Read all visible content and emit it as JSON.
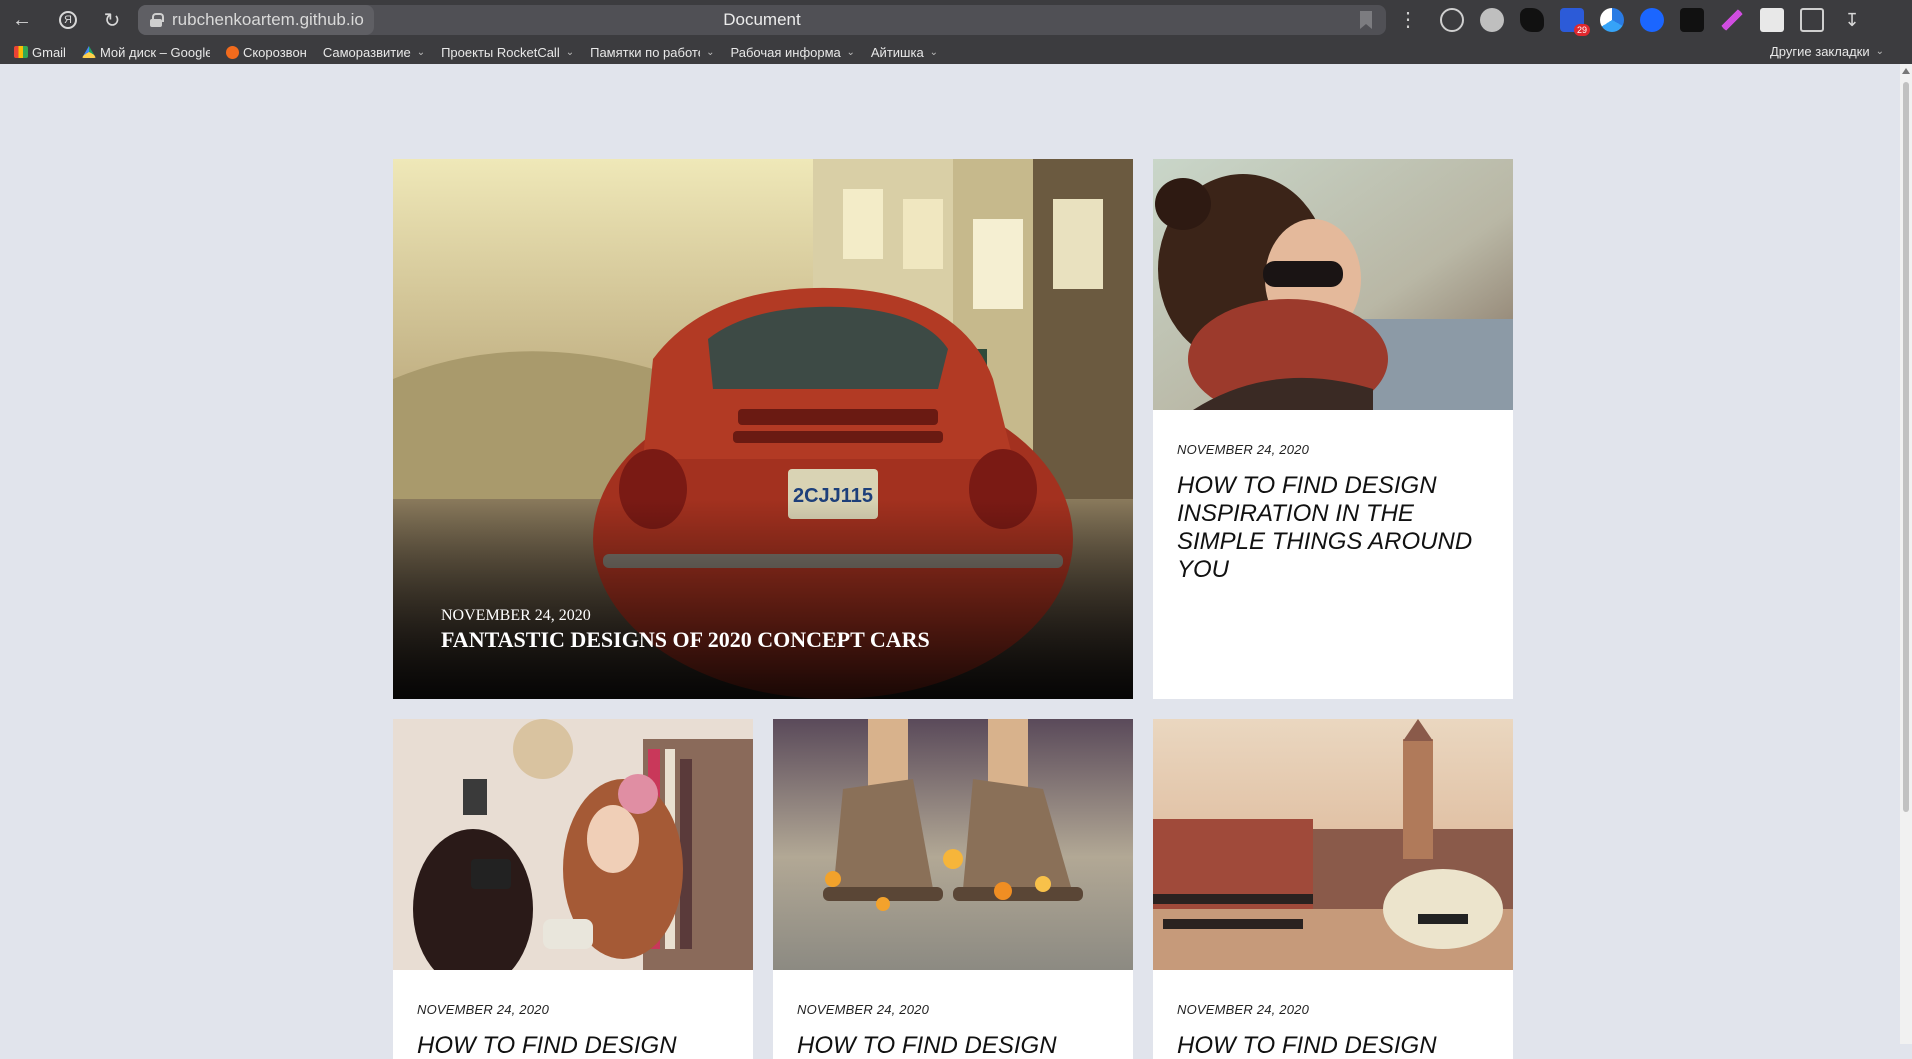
{
  "browser": {
    "url": "rubchenkoartem.github.io",
    "title": "Document",
    "extension_badge": "29",
    "bookmarks": [
      {
        "label": "Gmail",
        "icon": "gmail-icon",
        "color": "#ea4335",
        "folder": false
      },
      {
        "label": "Мой диск – Google",
        "icon": "google-drive-icon",
        "color": "#1fa463",
        "folder": false
      },
      {
        "label": "Скорозвон",
        "icon": "skorozvon-icon",
        "color": "#f26b1d",
        "folder": false
      },
      {
        "label": "Саморазвитие",
        "folder": true
      },
      {
        "label": "Проекты RocketCall",
        "folder": true
      },
      {
        "label": "Памятки по работе",
        "folder": true
      },
      {
        "label": "Рабочая информация",
        "folder": true
      },
      {
        "label": "Айтишка",
        "folder": true
      }
    ],
    "other_bookmarks": "Другие закладки"
  },
  "posts": {
    "featured": {
      "date": "NOVEMBER 24, 2020",
      "title": "FANTASTIC DESIGNS OF 2020 CONCEPT CARS",
      "image": "red-beetle-car-photo"
    },
    "side": {
      "date": "NOVEMBER 24, 2020",
      "title": "HOW TO FIND DESIGN INSPIRATION IN THE SIMPLE THINGS AROUND YOU",
      "image": "woman-sunglasses-scarf-photo"
    },
    "row": [
      {
        "date": "NOVEMBER 24, 2020",
        "title": "HOW TO FIND DESIGN",
        "image": "girls-camera-photo"
      },
      {
        "date": "NOVEMBER 24, 2020",
        "title": "HOW TO FIND DESIGN",
        "image": "boots-flowers-photo"
      },
      {
        "date": "NOVEMBER 24, 2020",
        "title": "HOW TO FIND DESIGN",
        "image": "town-square-car-photo"
      }
    ]
  }
}
